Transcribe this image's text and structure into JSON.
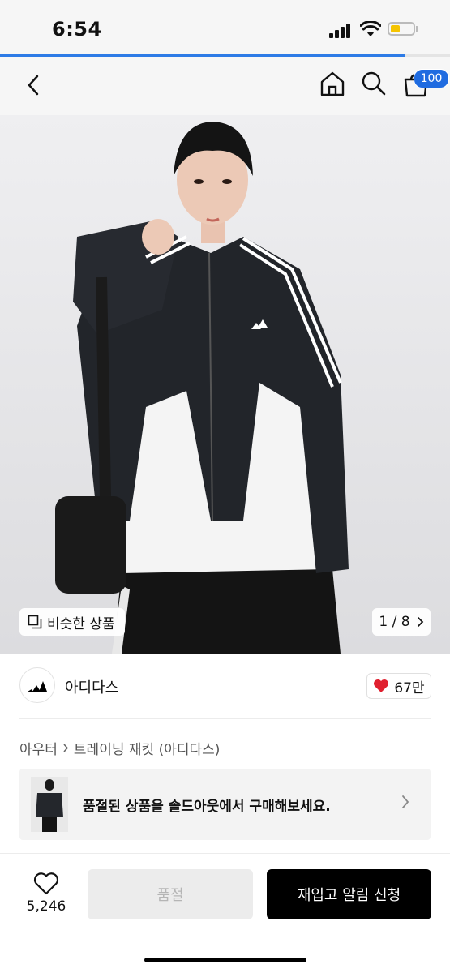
{
  "status_bar": {
    "time": "6:54",
    "progress_fraction": 0.9
  },
  "nav": {
    "cart_count": "100"
  },
  "hero": {
    "similar_label": "비슷한 상품",
    "page_indicator": "1 / 8"
  },
  "brand": {
    "name": "아디다스",
    "likes": "67만"
  },
  "breadcrumb": {
    "category": "아우터",
    "subcategory": "트레이닝 재킷 (아디다스)"
  },
  "soldout_banner": {
    "text": "품절된 상품을 솔드아웃에서 구매해보세요."
  },
  "bottom_bar": {
    "like_count": "5,246",
    "soldout_label": "품절",
    "restock_label": "재입고 알림 신청"
  },
  "colors": {
    "accent_blue": "#1f6be0",
    "like_red": "#e0202f",
    "cta_black": "#000000"
  }
}
